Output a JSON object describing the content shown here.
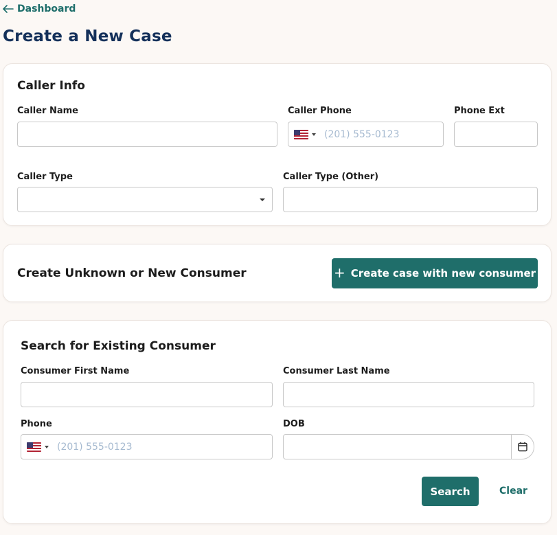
{
  "nav": {
    "back_label": "Dashboard",
    "back_icon": "arrow-left-icon"
  },
  "page": {
    "title": "Create a New Case"
  },
  "caller_info": {
    "title": "Caller Info",
    "caller_name": {
      "label": "Caller Name",
      "value": ""
    },
    "caller_phone": {
      "label": "Caller Phone",
      "placeholder": "(201) 555-0123",
      "country": "US"
    },
    "phone_ext": {
      "label": "Phone Ext",
      "value": ""
    },
    "caller_type": {
      "label": "Caller Type",
      "value": ""
    },
    "caller_type_other": {
      "label": "Caller Type (Other)",
      "value": ""
    }
  },
  "new_consumer": {
    "title": "Create Unknown or New Consumer",
    "button_label": "Create case with new consumer",
    "button_icon": "plus-icon"
  },
  "search": {
    "title": "Search for Existing Consumer",
    "first_name": {
      "label": "Consumer First Name",
      "value": ""
    },
    "last_name": {
      "label": "Consumer Last Name",
      "value": ""
    },
    "phone": {
      "label": "Phone",
      "placeholder": "(201) 555-0123",
      "country": "US"
    },
    "dob": {
      "label": "DOB",
      "value": "",
      "icon": "calendar-icon"
    },
    "search_label": "Search",
    "clear_label": "Clear"
  },
  "colors": {
    "accent": "#1f6e6a",
    "title": "#14305a",
    "background": "#fcf8f5",
    "placeholder": "#a6bad0"
  }
}
